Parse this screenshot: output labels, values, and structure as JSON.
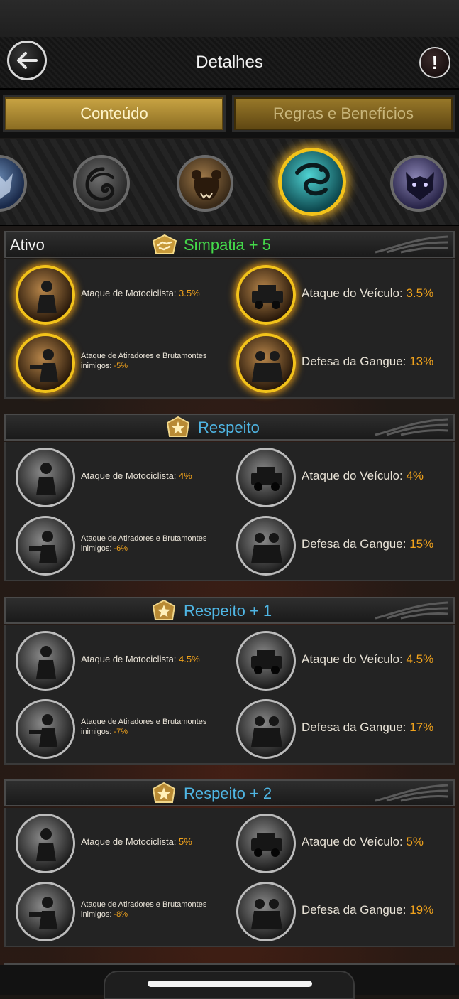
{
  "header": {
    "title": "Detalhes",
    "info_glyph": "!",
    "back_icon": "back-arrow-icon"
  },
  "tabs": [
    {
      "label": "Conteúdo",
      "active": true
    },
    {
      "label": "Regras e Benefícios",
      "active": false
    }
  ],
  "clans": [
    {
      "name": "wolf-emblem-icon",
      "selected": false
    },
    {
      "name": "wind-emblem-icon",
      "selected": false
    },
    {
      "name": "bear-emblem-icon",
      "selected": false
    },
    {
      "name": "dragon-emblem-icon",
      "selected": true
    },
    {
      "name": "panther-emblem-icon",
      "selected": false
    }
  ],
  "colors": {
    "accent_gold": "#f2c21a",
    "value_orange": "#f0a21c",
    "green_title": "#44d84a",
    "blue_title": "#4fb6e4"
  },
  "sections": [
    {
      "status": "Ativo",
      "title": "Simpatia + 5",
      "title_color": "#44d84a",
      "active": true,
      "perks": [
        {
          "label": "Ataque de Motociclista:",
          "value": "3.5%"
        },
        {
          "label": "Ataque do Veículo:",
          "value": "3.5%"
        },
        {
          "label": "Ataque de Atiradores e Brutamontes inimigos:",
          "value": "-5%"
        },
        {
          "label": "Defesa da Gangue:",
          "value": "13%"
        }
      ]
    },
    {
      "status": "",
      "title": "Respeito",
      "title_color": "#4fb6e4",
      "active": false,
      "perks": [
        {
          "label": "Ataque de Motociclista:",
          "value": "4%"
        },
        {
          "label": "Ataque do Veículo:",
          "value": "4%"
        },
        {
          "label": "Ataque de Atiradores e Brutamontes inimigos:",
          "value": "-6%"
        },
        {
          "label": "Defesa da Gangue:",
          "value": "15%"
        }
      ]
    },
    {
      "status": "",
      "title": "Respeito + 1",
      "title_color": "#4fb6e4",
      "active": false,
      "perks": [
        {
          "label": "Ataque de Motociclista:",
          "value": "4.5%"
        },
        {
          "label": "Ataque do Veículo:",
          "value": "4.5%"
        },
        {
          "label": "Ataque de Atiradores e Brutamontes inimigos:",
          "value": "-7%"
        },
        {
          "label": "Defesa da Gangue:",
          "value": "17%"
        }
      ]
    },
    {
      "status": "",
      "title": "Respeito + 2",
      "title_color": "#4fb6e4",
      "active": false,
      "perks": [
        {
          "label": "Ataque de Motociclista:",
          "value": "5%"
        },
        {
          "label": "Ataque do Veículo:",
          "value": "5%"
        },
        {
          "label": "Ataque de Atiradores e Brutamontes inimigos:",
          "value": "-8%"
        },
        {
          "label": "Defesa da Gangue:",
          "value": "19%"
        }
      ]
    }
  ]
}
